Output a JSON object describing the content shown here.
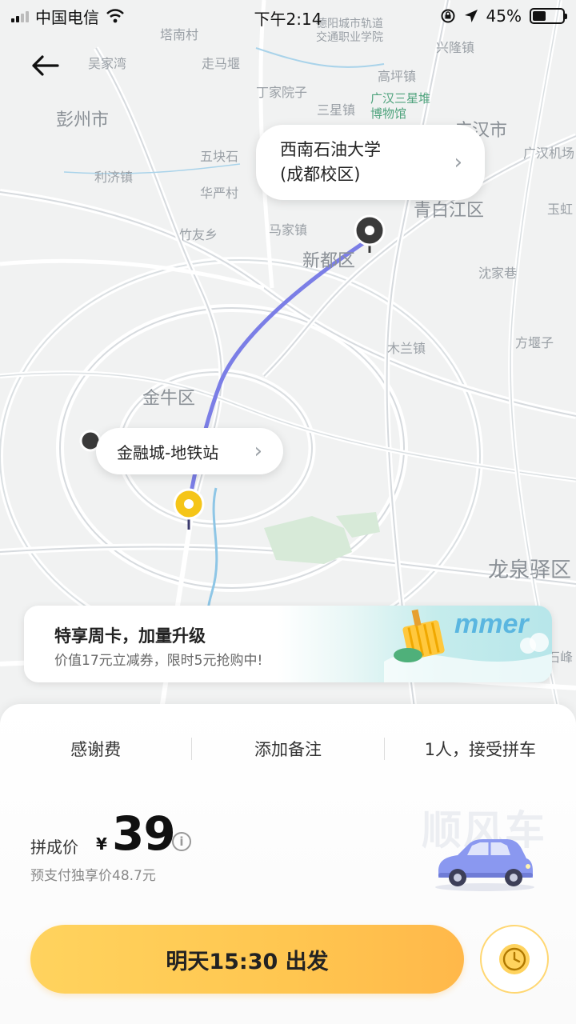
{
  "status_bar": {
    "carrier": "中国电信",
    "time": "下午2:14",
    "battery": "45%",
    "battery_level": 0.45
  },
  "map": {
    "places": [
      {
        "name": "塔南村"
      },
      {
        "name": "德阳城市轨道交通职业学院"
      },
      {
        "name": "兴隆镇"
      },
      {
        "name": "吴家湾"
      },
      {
        "name": "走马堰"
      },
      {
        "name": "高坪镇"
      },
      {
        "name": "丁家院子"
      },
      {
        "name": "彭州市"
      },
      {
        "name": "三星镇"
      },
      {
        "name": "广汉三星堆博物馆"
      },
      {
        "name": "广汉市"
      },
      {
        "name": "五块石"
      },
      {
        "name": "广汉机场"
      },
      {
        "name": "利济镇"
      },
      {
        "name": "华严村"
      },
      {
        "name": "青白江区"
      },
      {
        "name": "玉虹"
      },
      {
        "name": "竹友乡"
      },
      {
        "name": "马家镇"
      },
      {
        "name": "新都区"
      },
      {
        "name": "沈家巷"
      },
      {
        "name": "方堰子"
      },
      {
        "name": "木兰镇"
      },
      {
        "name": "金牛区"
      },
      {
        "name": "龙泉驿区"
      },
      {
        "name": "石峰"
      }
    ],
    "destination_label_line1": "西南石油大学",
    "destination_label_line2": "(成都校区)",
    "origin_label": "金融城-地铁站",
    "route_color": "#7b7ee6"
  },
  "promo": {
    "title": "特享周卡，加量升级",
    "subtitle": "价值17元立减券，限时5元抢购中!",
    "art_text": "mmer"
  },
  "options": {
    "thanks_fee": "感谢费",
    "add_note": "添加备注",
    "passengers": "1人，接受拼车"
  },
  "pricing": {
    "label": "拼成价",
    "currency": "¥",
    "price": "39",
    "info_icon": "i",
    "note": "预支付独享价48.7元"
  },
  "brand": {
    "watermark": "顺风车"
  },
  "action": {
    "depart_label": "明天15:30 出发"
  },
  "colors": {
    "accent_yellow": "#ffc650",
    "route": "#7b7ee6",
    "pin_origin": "#f5c518",
    "pin_dest": "#3a3a3a"
  }
}
